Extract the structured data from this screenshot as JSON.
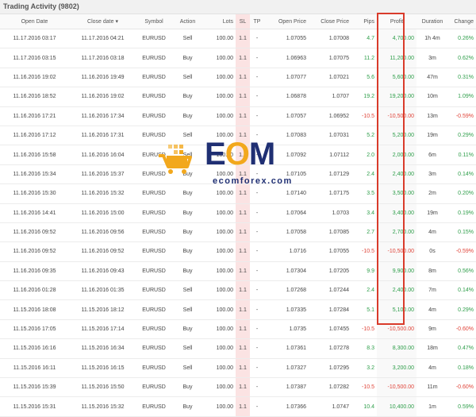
{
  "header": {
    "title": "Trading Activity (9802)"
  },
  "columns": [
    "Open Date",
    "Close date",
    "Symbol",
    "Action",
    "Lots",
    "SL",
    "TP",
    "Open Price",
    "Close Price",
    "Pips",
    "Profit",
    "Duration",
    "Change"
  ],
  "sort_indicator": "▾",
  "rows": [
    [
      "11.17.2016 03:17",
      "11.17.2016 04:21",
      "EURUSD",
      "Sell",
      "100.00",
      "1.1",
      "-",
      "1.07055",
      "1.07008",
      "4.7",
      "4,700.00",
      "1h 4m",
      "0.26%"
    ],
    [
      "11.17.2016 03:15",
      "11.17.2016 03:18",
      "EURUSD",
      "Buy",
      "100.00",
      "1.1",
      "-",
      "1.06963",
      "1.07075",
      "11.2",
      "11,200.00",
      "3m",
      "0.62%"
    ],
    [
      "11.16.2016 19:02",
      "11.16.2016 19:49",
      "EURUSD",
      "Sell",
      "100.00",
      "1.1",
      "-",
      "1.07077",
      "1.07021",
      "5.6",
      "5,600.00",
      "47m",
      "0.31%"
    ],
    [
      "11.16.2016 18:52",
      "11.16.2016 19:02",
      "EURUSD",
      "Buy",
      "100.00",
      "1.1",
      "-",
      "1.06878",
      "1.0707",
      "19.2",
      "19,200.00",
      "10m",
      "1.09%"
    ],
    [
      "11.16.2016 17:21",
      "11.16.2016 17:34",
      "EURUSD",
      "Buy",
      "100.00",
      "1.1",
      "-",
      "1.07057",
      "1.06952",
      "-10.5",
      "-10,500.00",
      "13m",
      "-0.59%"
    ],
    [
      "11.16.2016 17:12",
      "11.16.2016 17:31",
      "EURUSD",
      "Sell",
      "100.00",
      "1.1",
      "-",
      "1.07083",
      "1.07031",
      "5.2",
      "5,200.00",
      "19m",
      "0.29%"
    ],
    [
      "11.16.2016 15:58",
      "11.16.2016 16:04",
      "EURUSD",
      "Sell",
      "100.00",
      "1.1",
      "-",
      "1.07092",
      "1.07112",
      "2.0",
      "2,000.00",
      "6m",
      "0.11%"
    ],
    [
      "11.16.2016 15:34",
      "11.16.2016 15:37",
      "EURUSD",
      "Buy",
      "100.00",
      "1.1",
      "-",
      "1.07105",
      "1.07129",
      "2.4",
      "2,400.00",
      "3m",
      "0.14%"
    ],
    [
      "11.16.2016 15:30",
      "11.16.2016 15:32",
      "EURUSD",
      "Buy",
      "100.00",
      "1.1",
      "-",
      "1.07140",
      "1.07175",
      "3.5",
      "3,500.00",
      "2m",
      "0.20%"
    ],
    [
      "11.16.2016 14:41",
      "11.16.2016 15:00",
      "EURUSD",
      "Buy",
      "100.00",
      "1.1",
      "-",
      "1.07064",
      "1.0703",
      "3.4",
      "3,400.00",
      "19m",
      "0.19%"
    ],
    [
      "11.16.2016 09:52",
      "11.16.2016 09:56",
      "EURUSD",
      "Buy",
      "100.00",
      "1.1",
      "-",
      "1.07058",
      "1.07085",
      "2.7",
      "2,700.00",
      "4m",
      "0.15%"
    ],
    [
      "11.16.2016 09:52",
      "11.16.2016 09:52",
      "EURUSD",
      "Buy",
      "100.00",
      "1.1",
      "-",
      "1.0716",
      "1.07055",
      "-10.5",
      "-10,500.00",
      "0s",
      "-0.59%"
    ],
    [
      "11.16.2016 09:35",
      "11.16.2016 09:43",
      "EURUSD",
      "Buy",
      "100.00",
      "1.1",
      "-",
      "1.07304",
      "1.07205",
      "9.9",
      "9,900.00",
      "8m",
      "0.56%"
    ],
    [
      "11.16.2016 01:28",
      "11.16.2016 01:35",
      "EURUSD",
      "Sell",
      "100.00",
      "1.1",
      "-",
      "1.07268",
      "1.07244",
      "2.4",
      "2,400.00",
      "7m",
      "0.14%"
    ],
    [
      "11.15.2016 18:08",
      "11.15.2016 18:12",
      "EURUSD",
      "Sell",
      "100.00",
      "1.1",
      "-",
      "1.07335",
      "1.07284",
      "5.1",
      "5,100.00",
      "4m",
      "0.29%"
    ],
    [
      "11.15.2016 17:05",
      "11.15.2016 17:14",
      "EURUSD",
      "Buy",
      "100.00",
      "1.1",
      "-",
      "1.0735",
      "1.07455",
      "-10.5",
      "-10,500.00",
      "9m",
      "-0.60%"
    ],
    [
      "11.15.2016 16:16",
      "11.15.2016 16:34",
      "EURUSD",
      "Sell",
      "100.00",
      "1.1",
      "-",
      "1.07361",
      "1.07278",
      "8.3",
      "8,300.00",
      "18m",
      "0.47%"
    ],
    [
      "11.15.2016 16:11",
      "11.15.2016 16:15",
      "EURUSD",
      "Sell",
      "100.00",
      "1.1",
      "-",
      "1.07327",
      "1.07295",
      "3.2",
      "3,200.00",
      "4m",
      "0.18%"
    ],
    [
      "11.15.2016 15:39",
      "11.15.2016 15:50",
      "EURUSD",
      "Buy",
      "100.00",
      "1.1",
      "-",
      "1.07387",
      "1.07282",
      "-10.5",
      "-10,500.00",
      "11m",
      "-0.60%"
    ],
    [
      "11.15.2016 15:31",
      "11.15.2016 15:32",
      "EURUSD",
      "Buy",
      "100.00",
      "1.1",
      "-",
      "1.07366",
      "1.0747",
      "10.4",
      "10,400.00",
      "1m",
      "0.59%"
    ]
  ],
  "watermark": {
    "brand_letters": "ECOM",
    "site": "ecomforex.com"
  },
  "colors": {
    "positive": "#2e9e4a",
    "negative": "#e0453a",
    "highlight": "#d93b2b",
    "brand_blue": "#1f2f73",
    "brand_orange": "#f2a81d"
  }
}
